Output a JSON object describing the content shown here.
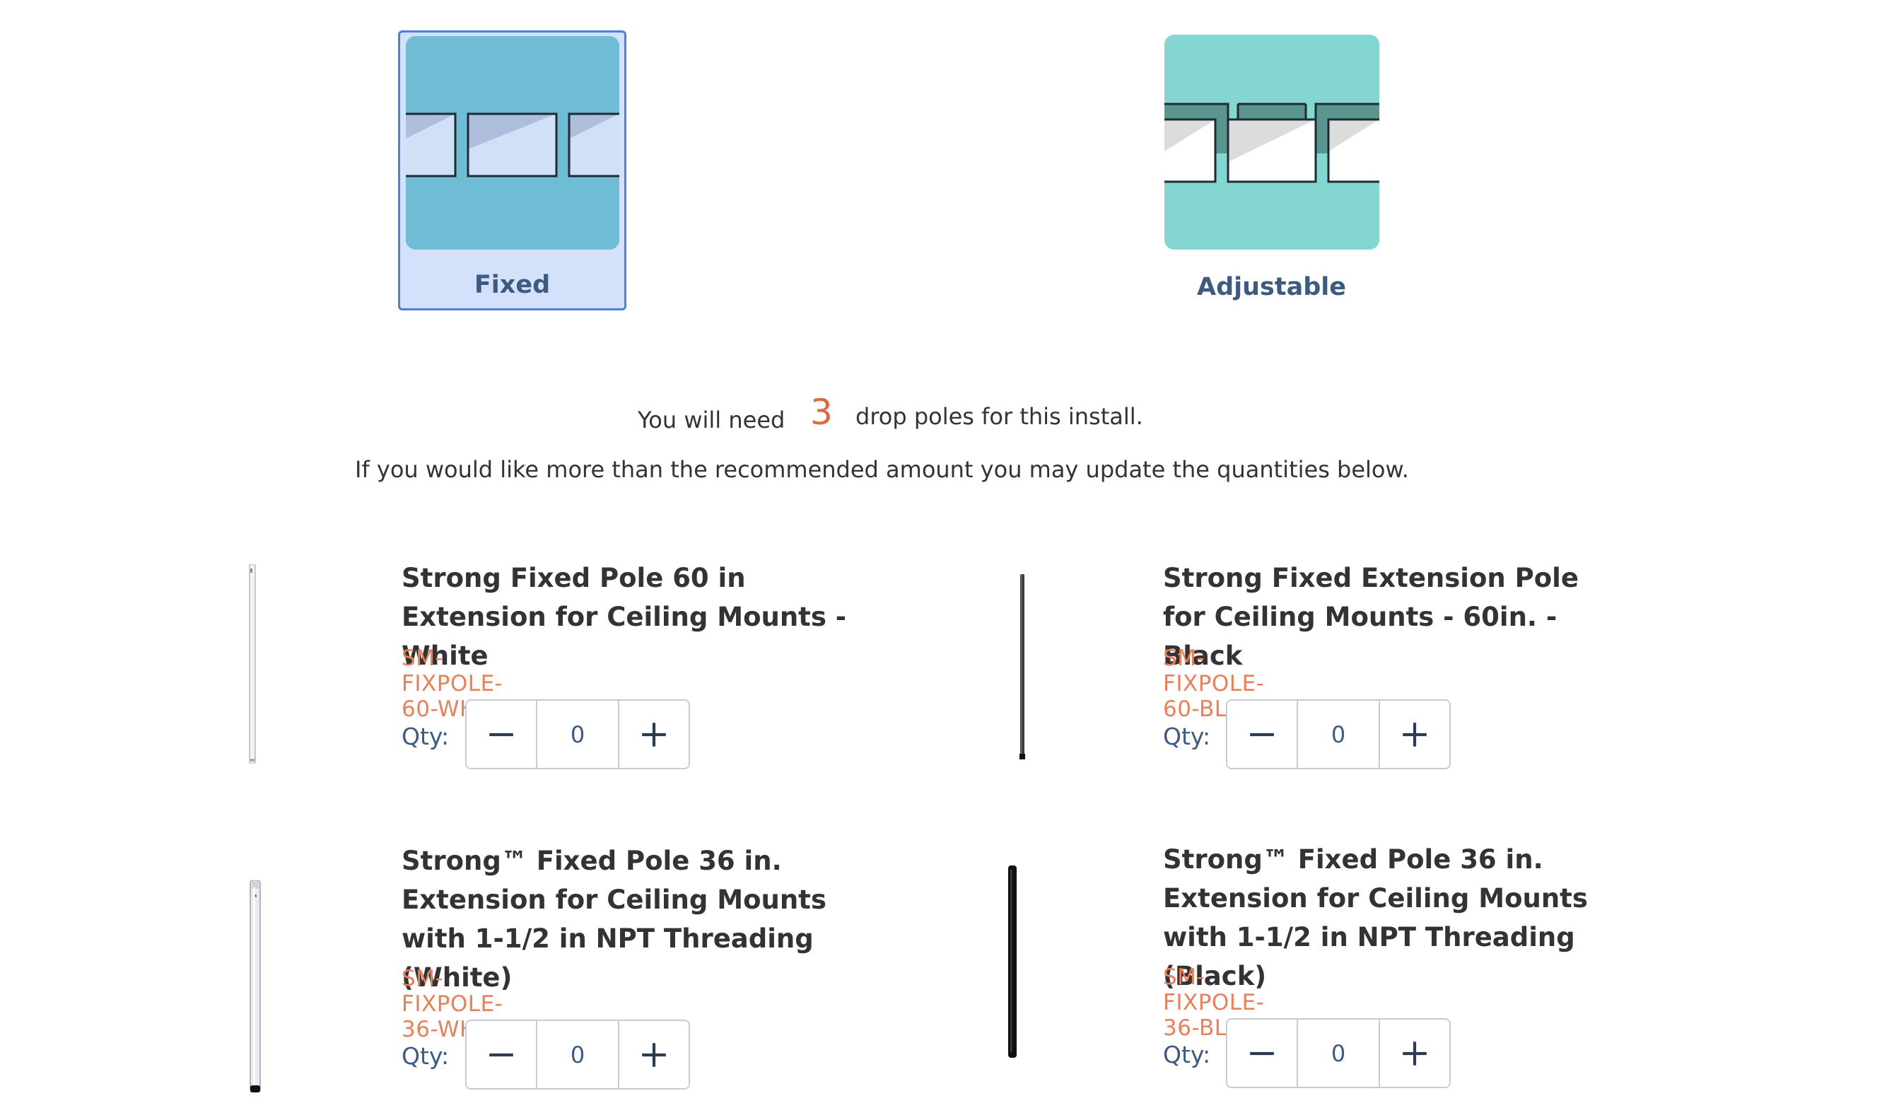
{
  "pole_types": {
    "fixed": {
      "label": "Fixed",
      "selected": true,
      "icon": "fixed-pole-diagram"
    },
    "adjustable": {
      "label": "Adjustable",
      "selected": false,
      "icon": "adjustable-pole-diagram"
    }
  },
  "recommendation": {
    "prefix": "You will need",
    "count": "3",
    "suffix": "drop poles for this install.",
    "note": "If you would like more than the recommended amount you may update the quantities below."
  },
  "products": [
    {
      "title": "Strong Fixed Pole 60 in Extension for Ceiling Mounts - White",
      "sku": "SM-FIXPOLE-60-WH",
      "qty_label": "Qty:",
      "qty": "0",
      "color": "white"
    },
    {
      "title": "Strong Fixed Extension Pole for Ceiling Mounts - 60in. - Black",
      "sku": "SM-FIXPOLE-60-BLK",
      "qty_label": "Qty:",
      "qty": "0",
      "color": "black"
    },
    {
      "title": "Strong™ Fixed Pole 36 in. Extension for Ceiling Mounts with 1-1/2 in NPT Threading (White)",
      "sku": "SM-FIXPOLE-36-WH",
      "qty_label": "Qty:",
      "qty": "0",
      "color": "white"
    },
    {
      "title": "Strong™ Fixed Pole 36 in. Extension for Ceiling Mounts with 1-1/2 in NPT Threading (Black)",
      "sku": "SM-FIXPOLE-36-BLK",
      "qty_label": "Qty:",
      "qty": "0",
      "color": "black"
    }
  ],
  "colors": {
    "accent": "#e0663c",
    "sku": "#e8805a",
    "label": "#3d5a80",
    "selected_bg": "#d3e2fa",
    "selected_border": "#4a7ee0"
  },
  "icons": {
    "decrement": "minus-icon",
    "increment": "plus-icon"
  }
}
